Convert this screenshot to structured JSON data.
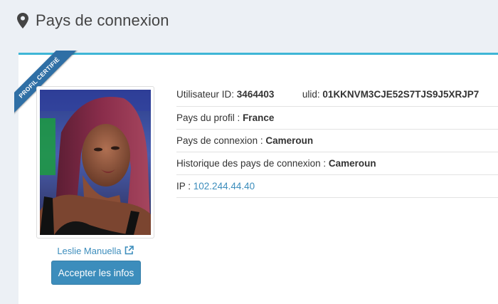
{
  "header": {
    "title": "Pays de connexion",
    "icon": "map-marker-icon"
  },
  "ribbon": {
    "label": "PROFIL CERTIFIÉ",
    "color": "#2f6fa5"
  },
  "profile": {
    "name": "Leslie Manuella",
    "accept_label": "Accepter les infos"
  },
  "info": {
    "user_id_label": "Utilisateur ID:",
    "user_id": "3464403",
    "ulid_label": "ulid:",
    "ulid": "01KKNVM3CJE52S7TJS9J5XRJP7",
    "profile_country_label": "Pays du profil :",
    "profile_country": "France",
    "connection_country_label": "Pays de connexion :",
    "connection_country": "Cameroun",
    "history_label": "Historique des pays de connexion :",
    "history": "Cameroun",
    "ip_label": "IP :",
    "ip": "102.244.44.40"
  },
  "colors": {
    "accent": "#3c8dbc",
    "box_top_border": "#3fb6d6",
    "background": "#ecf0f5"
  }
}
